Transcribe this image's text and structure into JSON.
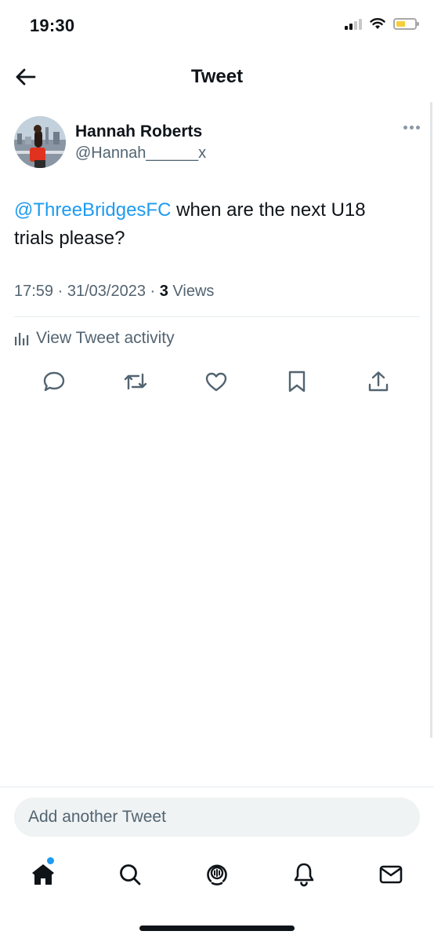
{
  "status_bar": {
    "time": "19:30"
  },
  "header": {
    "title": "Tweet"
  },
  "tweet": {
    "author_name": "Hannah Roberts",
    "author_handle": "@Hannah______x",
    "mention": "@ThreeBridgesFC",
    "body": " when are the next U18 trials please?",
    "time": "17:59",
    "date": "31/03/2023",
    "views_count": "3",
    "views_label": "Views"
  },
  "activity": {
    "label": "View Tweet activity"
  },
  "compose": {
    "placeholder": "Add another Tweet"
  },
  "colors": {
    "accent": "#1d9bf0",
    "secondary_text": "#536471",
    "battery": "#f6cf3a"
  },
  "icons": {
    "actions": [
      "reply-icon",
      "retweet-icon",
      "like-icon",
      "bookmark-icon",
      "share-icon"
    ],
    "tabs": [
      "home-icon",
      "search-icon",
      "spaces-icon",
      "notifications-icon",
      "messages-icon"
    ]
  }
}
